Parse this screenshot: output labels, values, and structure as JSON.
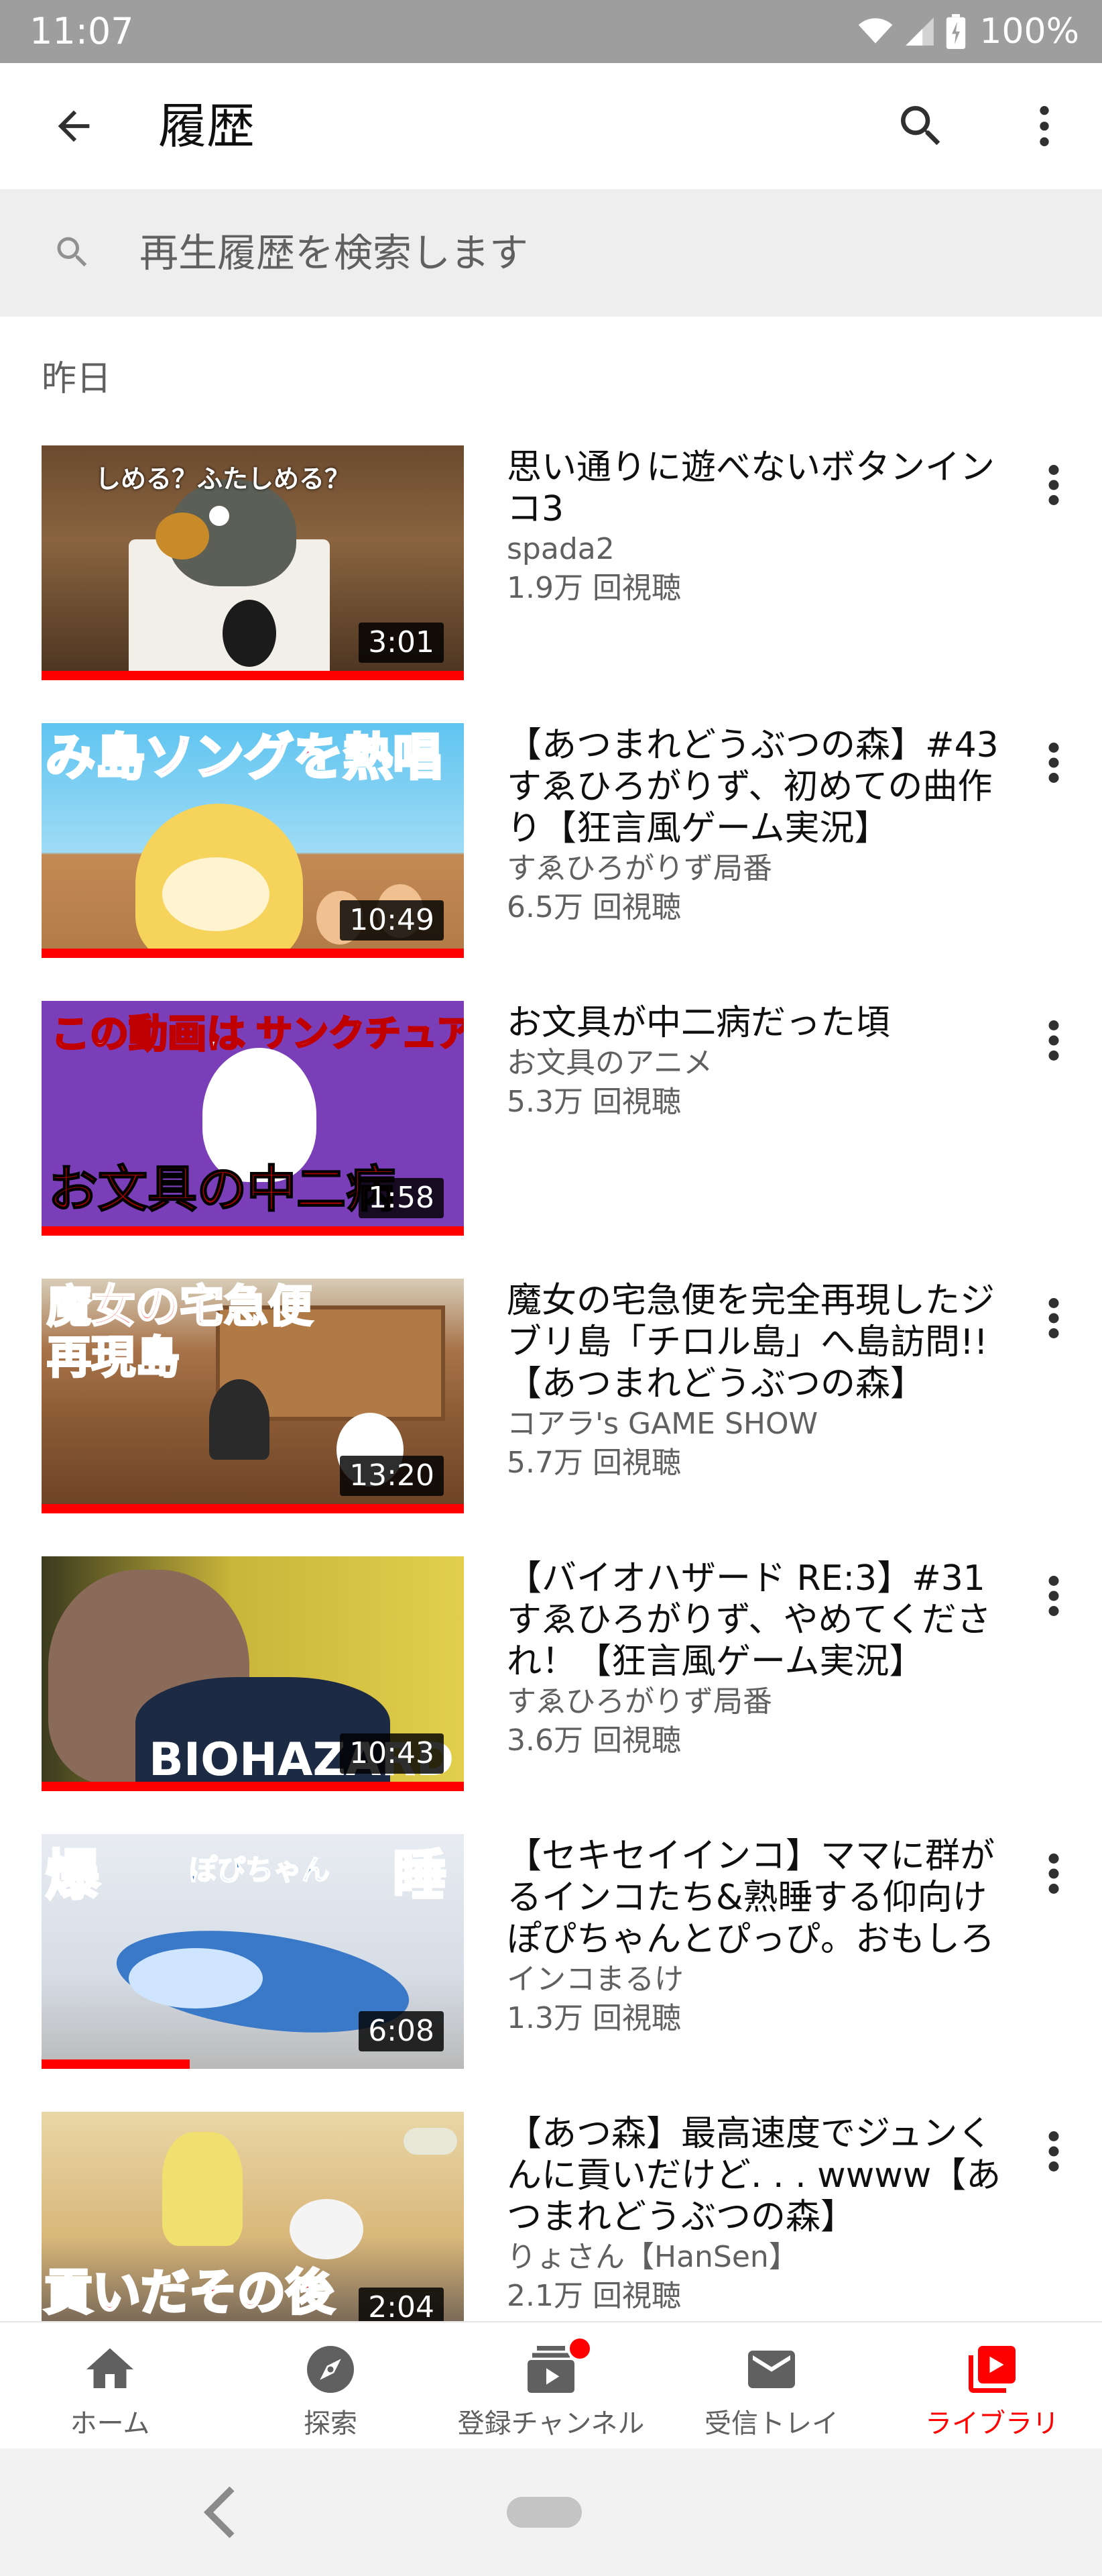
{
  "status_bar": {
    "time": "11:07",
    "battery": "100%"
  },
  "app_bar": {
    "title": "履歴"
  },
  "search": {
    "placeholder": "再生履歴を検索します"
  },
  "section": {
    "heading": "昨日"
  },
  "videos": [
    {
      "title": "思い通りに遊べないボタンインコ3",
      "channel": "spada2",
      "views": "1.9万 回視聴",
      "duration": "3:01",
      "progress": 1.0,
      "thumb_text": "しめる？ふたしめる？"
    },
    {
      "title": "【あつまれどうぶつの森】#43 すゑひろがりず、初めての曲作り【狂言風ゲーム実況】",
      "channel": "すゑひろがりず局番",
      "views": "6.5万 回視聴",
      "duration": "10:49",
      "progress": 1.0,
      "thumb_text": "み島ソングを熱唱"
    },
    {
      "title": "お文具が中二病だった頃",
      "channel": "お文具のアニメ",
      "views": "5.3万 回視聴",
      "duration": "1:58",
      "progress": 1.0,
      "thumb_text_top_left": "この動画は",
      "thumb_text_top_right": "サンクチュアリ",
      "thumb_text_bottom": "お文具の中二病"
    },
    {
      "title": "魔女の宅急便を完全再現したジブリ島「チロル島」へ島訪問!!【あつまれどうぶつの森】",
      "channel": "コアラ's GAME SHOW",
      "views": "5.7万 回視聴",
      "duration": "13:20",
      "progress": 1.0,
      "thumb_text_1": "魔女の宅急便",
      "thumb_text_2": "再現島"
    },
    {
      "title": "【バイオハザード RE:3】#31 すゑひろがりず、やめてくだされ！【狂言風ゲーム実況】",
      "channel": "すゑひろがりず局番",
      "views": "3.6万 回視聴",
      "duration": "10:43",
      "progress": 1.0,
      "thumb_text": "BIOHAZARD RE:3"
    },
    {
      "title": "【セキセイインコ】ママに群がるインコたち&熟睡する仰向けぽぴちゃんとぴっぴ。おもしろ",
      "channel": "インコまるけ",
      "views": "1.3万 回視聴",
      "duration": "6:08",
      "progress": 0.35,
      "thumb_text_left": "爆",
      "thumb_text_mid": "ぽぴちゃん",
      "thumb_text_right": "睡"
    },
    {
      "title": "【あつ森】最高速度でジュンくんに貢いだけど. . . wwww【あつまれどうぶつの森】",
      "channel": "りょさん【HanSen】",
      "views": "2.1万 回視聴",
      "duration": "2:04",
      "progress": 0.0,
      "thumb_text": "貢いだその後"
    }
  ],
  "bottom_nav": [
    {
      "label": "ホーム",
      "icon": "home-icon"
    },
    {
      "label": "探索",
      "icon": "explore-icon"
    },
    {
      "label": "登録チャンネル",
      "icon": "subscriptions-icon"
    },
    {
      "label": "受信トレイ",
      "icon": "inbox-icon"
    },
    {
      "label": "ライブラリ",
      "icon": "library-icon",
      "active": true
    }
  ],
  "colors": {
    "accent": "#ff0000",
    "status_bar": "#9e9e9e",
    "search_bg": "#eeeeee",
    "secondary_text": "#606060"
  }
}
